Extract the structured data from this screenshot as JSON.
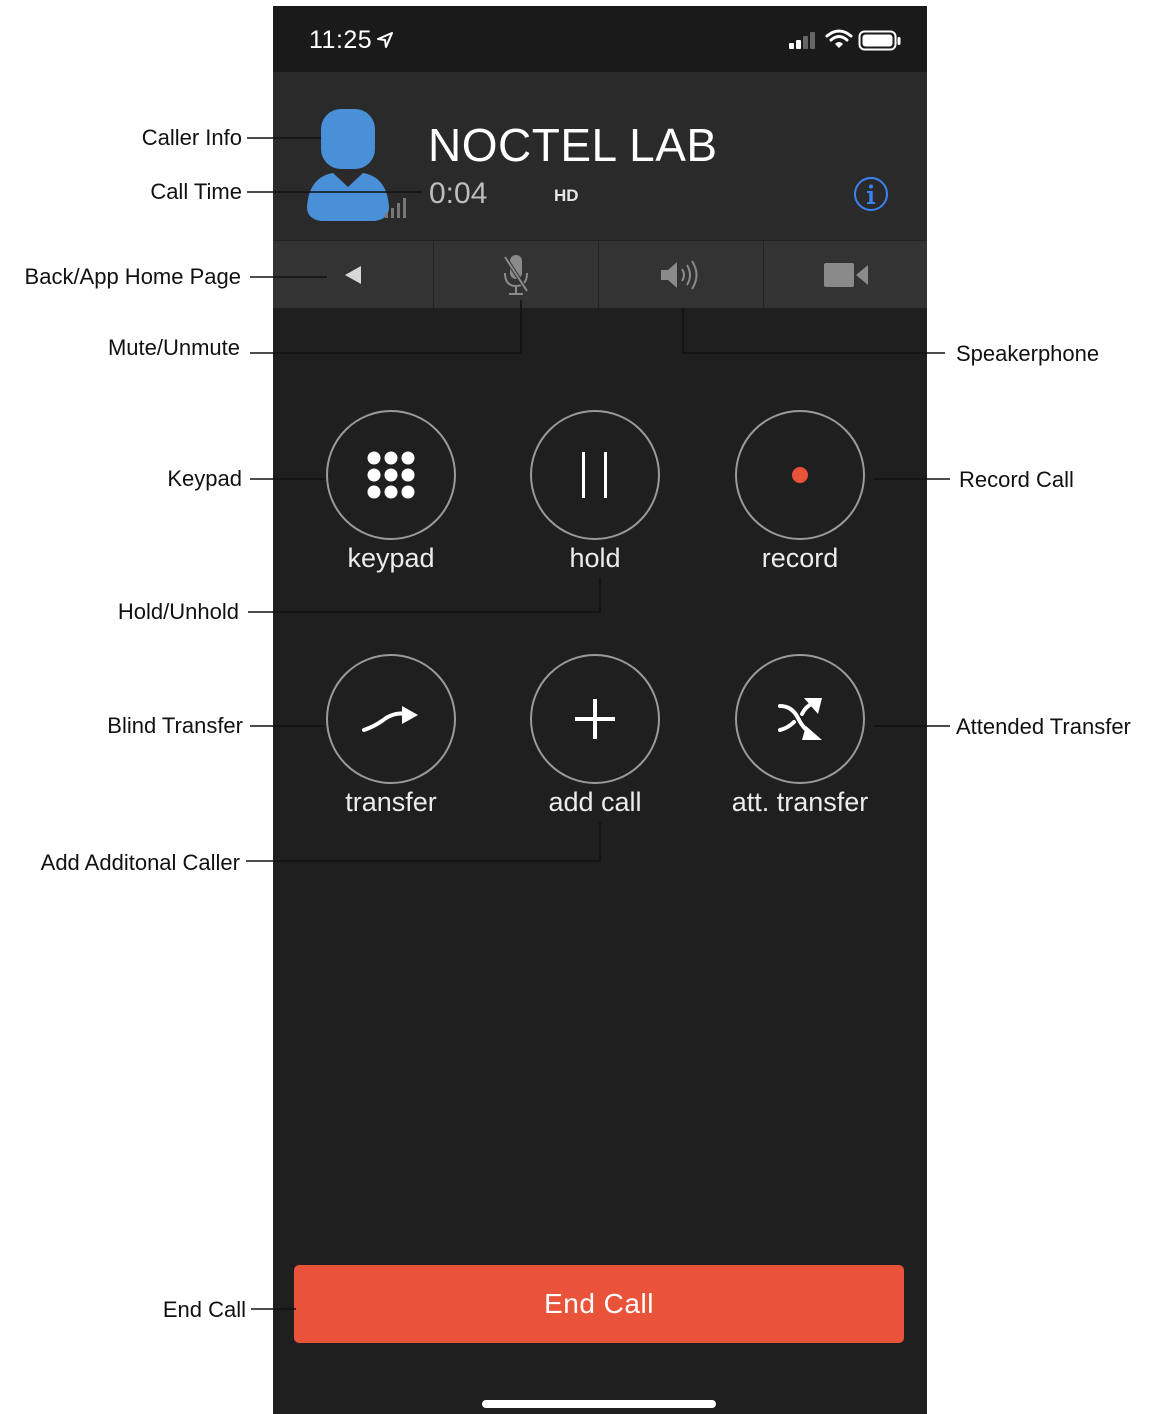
{
  "status_bar": {
    "time": "11:25"
  },
  "caller": {
    "name": "NOCTEL LAB",
    "call_time": "0:04",
    "quality_badge": "HD"
  },
  "action_bar": [
    "back-icon",
    "microphone-muted-icon",
    "speaker-icon",
    "video-camera-icon"
  ],
  "controls": [
    {
      "label": "keypad",
      "icon": "keypad-icon"
    },
    {
      "label": "hold",
      "icon": "pause-icon"
    },
    {
      "label": "record",
      "icon": "record-dot-icon",
      "icon_color": "#e8533a"
    },
    {
      "label": "transfer",
      "icon": "transfer-arrow-icon"
    },
    {
      "label": "add call",
      "icon": "plus-icon"
    },
    {
      "label": "att. transfer",
      "icon": "shuffle-arrows-icon"
    }
  ],
  "end_call_label": "End Call",
  "annotations": {
    "caller_info": "Caller Info",
    "call_time": "Call Time",
    "back_home": "Back/App Home Page",
    "mute": "Mute/Unmute",
    "speakerphone": "Speakerphone",
    "keypad": "Keypad",
    "record_call": "Record Call",
    "hold_unhold": "Hold/Unhold",
    "blind_transfer": "Blind Transfer",
    "attended_transfer": "Attended Transfer",
    "add_caller": "Add Additonal Caller",
    "end_call": "End Call"
  },
  "colors": {
    "accent_end_call": "#e8533a",
    "avatar_blue": "#4a90d9",
    "info_blue": "#3b82f6",
    "background": "#1f1f1f"
  }
}
